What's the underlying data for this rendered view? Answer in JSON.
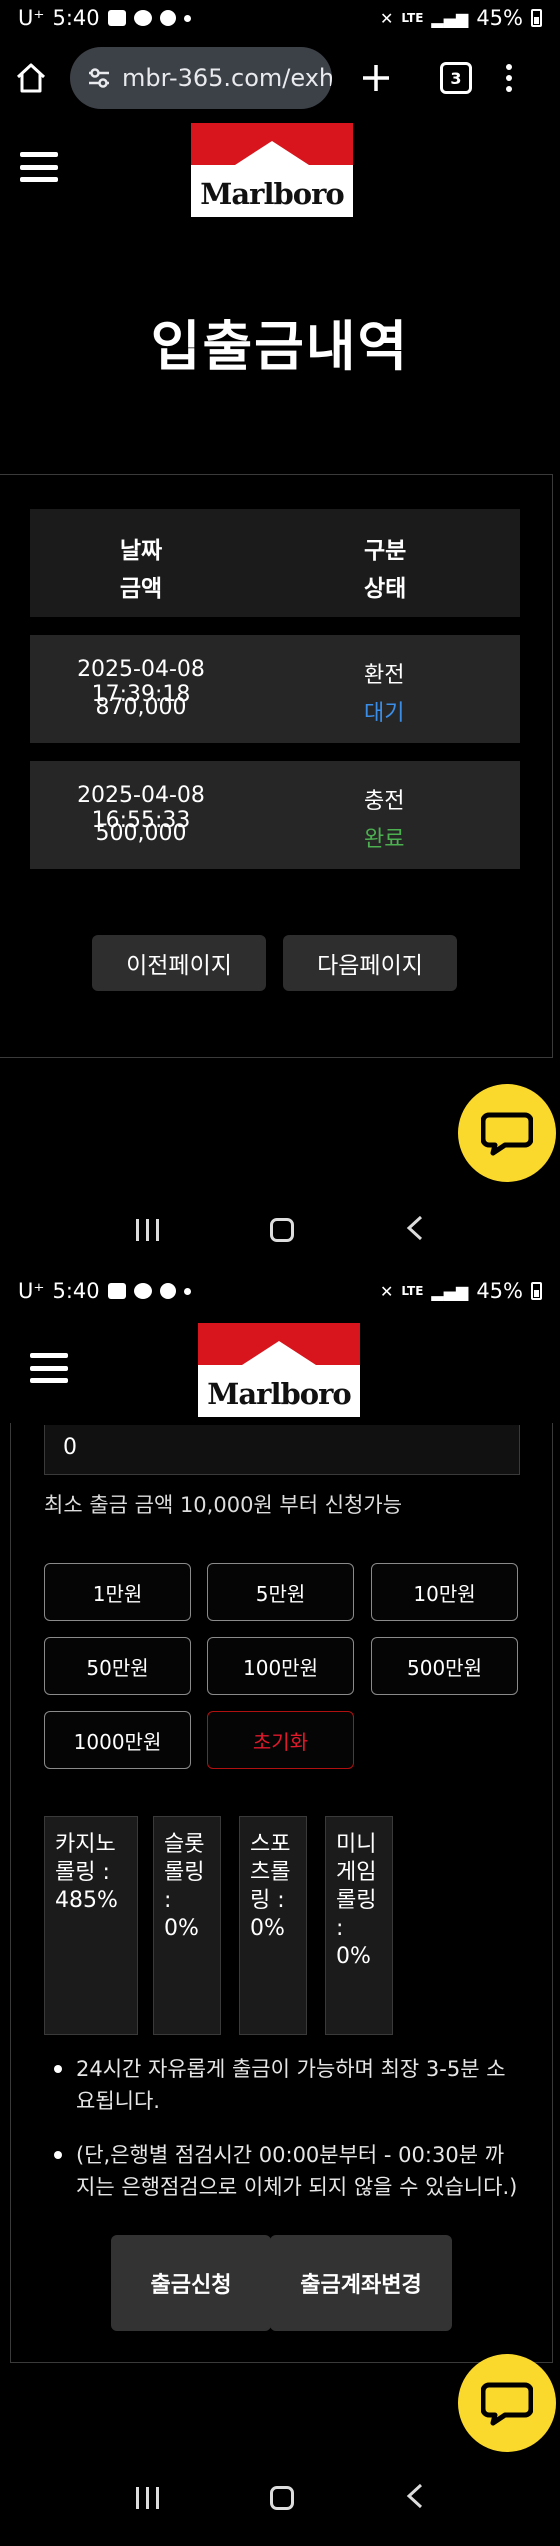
{
  "status_bar": {
    "carrier": "U⁺",
    "time": "5:40",
    "network": "LTE",
    "battery": "45%"
  },
  "browser": {
    "url": "mbr-365.com/exh",
    "tab_count": "3"
  },
  "header": {
    "logo_text": "Marlboro"
  },
  "history": {
    "title": "입출금내역",
    "columns": {
      "date": "날짜",
      "amount": "금액",
      "type": "구분",
      "status": "상태"
    },
    "rows": [
      {
        "date": "2025-04-08 17:39:18",
        "amount": "870,000",
        "type": "환전",
        "status": "대기"
      },
      {
        "date": "2025-04-08 16:55:33",
        "amount": "500,000",
        "type": "충전",
        "status": "완료"
      }
    ],
    "prev_label": "이전페이지",
    "next_label": "다음페이지"
  },
  "withdraw": {
    "amount_value": "0",
    "min_note": "최소 출금 금액 10,000원 부터 신청가능",
    "amount_buttons": [
      "1만원",
      "5만원",
      "10만원",
      "50만원",
      "100만원",
      "500만원",
      "1000만원"
    ],
    "reset_label": "초기화",
    "rolling": [
      "카지노 롤링 : 485%",
      "슬롯롤링 : 0%",
      "스포츠롤링 : 0%",
      "미니게임롤링 : 0%"
    ],
    "notes": [
      "24시간 자유롭게 출금이 가능하며 최장 3-5분 소요됩니다.",
      "(단,은행별 점검시간 00:00분부터 - 00:30분 까지는 은행점검으로 이체가 되지 않을 수 있습니다.)"
    ],
    "submit_label": "출금신청",
    "change_account_label": "출금계좌변경"
  },
  "colors": {
    "background": "#000000",
    "logo_red": "#d8151c",
    "kakao_yellow": "#fbd92c",
    "status_waiting": "#3b8ee8",
    "status_done": "#4caf50",
    "reset_red": "#e0192b"
  },
  "icons": [
    "home-icon",
    "tune-icon",
    "plus-icon",
    "tabs-icon",
    "overflow-menu-icon",
    "hamburger-icon",
    "chat-icon",
    "nav-recent-icon",
    "nav-home-icon",
    "nav-back-icon"
  ]
}
